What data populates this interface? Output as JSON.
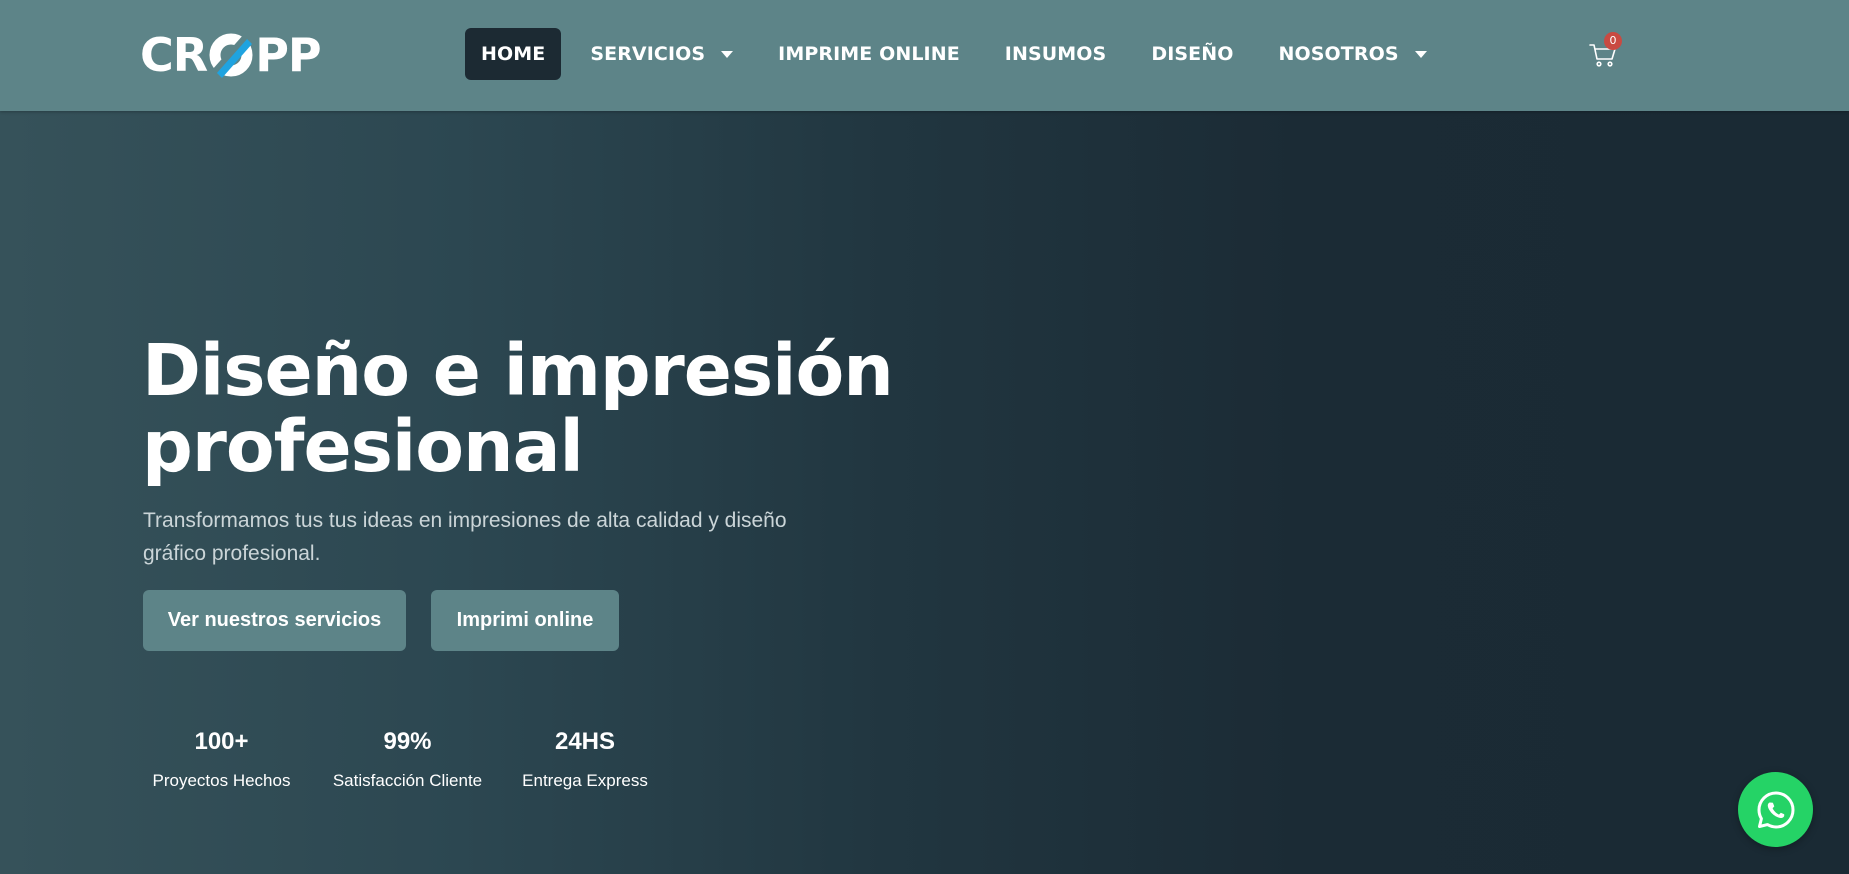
{
  "header": {
    "logo": {
      "text_before": "CR",
      "text_after": "PP",
      "icon": "logo-o-slash-icon"
    },
    "nav": [
      {
        "label": "HOME",
        "active": true,
        "has_dropdown": false
      },
      {
        "label": "SERVICIOS",
        "active": false,
        "has_dropdown": true
      },
      {
        "label": "IMPRIME ONLINE",
        "active": false,
        "has_dropdown": false
      },
      {
        "label": "INSUMOS",
        "active": false,
        "has_dropdown": false
      },
      {
        "label": "DISEÑO",
        "active": false,
        "has_dropdown": false
      },
      {
        "label": "NOSOTROS",
        "active": false,
        "has_dropdown": true
      }
    ],
    "cart": {
      "icon": "cart-icon",
      "count": "0"
    }
  },
  "hero": {
    "title_line1": "Diseño e impresión",
    "title_line2": "profesional",
    "subtitle_line1": "Transformamos tus tus ideas en impresiones de alta calidad y diseño",
    "subtitle_line2": "gráfico profesional.",
    "buttons": {
      "services": "Ver nuestros servicios",
      "print": "Imprimi online"
    },
    "stats": [
      {
        "value": "100+",
        "label": "Proyectos Hechos"
      },
      {
        "value": "99%",
        "label": "Satisfacción Cliente"
      },
      {
        "value": "24HS",
        "label": "Entrega Express"
      }
    ]
  },
  "floating": {
    "whatsapp_icon": "whatsapp-icon"
  },
  "colors": {
    "header_bg": "#5d8488",
    "hero_bg_dark": "#1a2a34",
    "hero_bg_light": "#36525a",
    "button_bg": "#5d8488",
    "nav_active_bg": "#1c2a33",
    "logo_accent": "#1fa3e0",
    "cart_badge": "#c94a42",
    "whatsapp": "#25d366"
  }
}
